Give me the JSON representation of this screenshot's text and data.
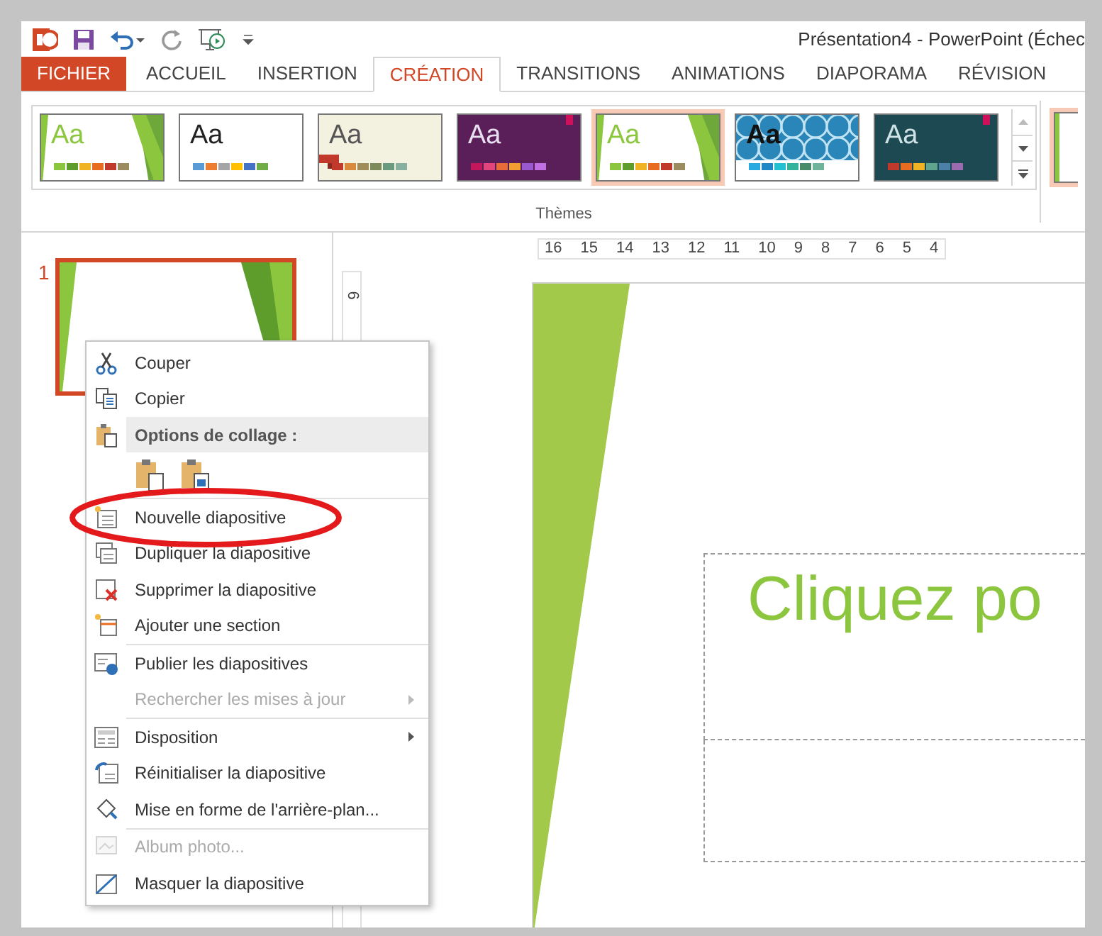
{
  "window": {
    "title": "Présentation4 - PowerPoint (Échec"
  },
  "file_button": {
    "label": "FICHIER"
  },
  "tabs": [
    {
      "label": "ACCUEIL",
      "selected": false
    },
    {
      "label": "INSERTION",
      "selected": false
    },
    {
      "label": "CRÉATION",
      "selected": true
    },
    {
      "label": "TRANSITIONS",
      "selected": false
    },
    {
      "label": "ANIMATIONS",
      "selected": false
    },
    {
      "label": "DIAPORAMA",
      "selected": false
    },
    {
      "label": "RÉVISION",
      "selected": false
    }
  ],
  "themes": {
    "label": "Thèmes",
    "items": [
      {
        "sample": "Aa",
        "kind": "facet",
        "selected": false
      },
      {
        "sample": "Aa",
        "kind": "office",
        "selected": false
      },
      {
        "sample": "Aa",
        "kind": "retro",
        "selected": false
      },
      {
        "sample": "Aa",
        "kind": "ion",
        "selected": false
      },
      {
        "sample": "Aa",
        "kind": "facet",
        "selected": true
      },
      {
        "sample": "Aa",
        "kind": "pattern",
        "selected": false
      },
      {
        "sample": "Aa",
        "kind": "slate",
        "selected": false
      }
    ]
  },
  "slides": [
    {
      "number": "1",
      "selected": true
    }
  ],
  "ruler_h": [
    "16",
    "15",
    "14",
    "13",
    "12",
    "11",
    "10",
    "9",
    "8",
    "7",
    "6",
    "5",
    "4"
  ],
  "ruler_v": [
    "6"
  ],
  "slide": {
    "title": "Cliquez po"
  },
  "context_menu": {
    "groups": [
      [
        {
          "label": "Couper",
          "kind": "item",
          "disabled": false,
          "submenu": false
        },
        {
          "label": "Copier",
          "kind": "item",
          "disabled": false,
          "submenu": false
        },
        {
          "label": "Options de collage :",
          "kind": "header"
        },
        {
          "kind": "paste"
        }
      ],
      [
        {
          "label": "Nouvelle diapositive",
          "kind": "item",
          "disabled": false,
          "submenu": false
        },
        {
          "label": "Dupliquer la diapositive",
          "kind": "item",
          "disabled": false,
          "submenu": false
        },
        {
          "label": "Supprimer la diapositive",
          "kind": "item",
          "disabled": false,
          "submenu": false
        },
        {
          "label": "Ajouter une section",
          "kind": "item",
          "disabled": false,
          "submenu": false
        }
      ],
      [
        {
          "label": "Publier les diapositives",
          "kind": "item",
          "disabled": false,
          "submenu": false
        },
        {
          "label": "Rechercher les mises à jour",
          "kind": "item",
          "disabled": true,
          "submenu": true
        }
      ],
      [
        {
          "label": "Disposition",
          "kind": "item",
          "disabled": false,
          "submenu": true
        },
        {
          "label": "Réinitialiser la diapositive",
          "kind": "item",
          "disabled": false,
          "submenu": false
        },
        {
          "label": "Mise en forme de l'arrière-plan...",
          "kind": "item",
          "disabled": false,
          "submenu": false
        }
      ],
      [
        {
          "label": "Album photo...",
          "kind": "item",
          "disabled": true,
          "submenu": false
        },
        {
          "label": "Masquer la diapositive",
          "kind": "item",
          "disabled": false,
          "submenu": false
        }
      ]
    ]
  }
}
